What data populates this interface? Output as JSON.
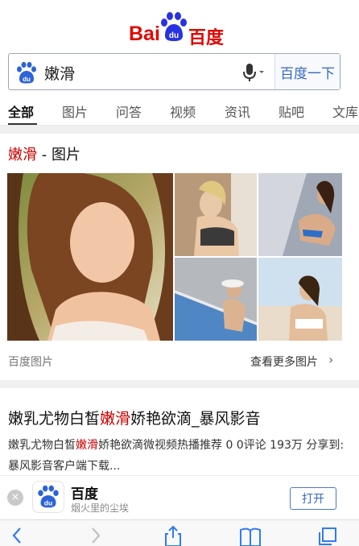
{
  "logo": {
    "word": "Bai",
    "paw_text": "du",
    "cn": "百度"
  },
  "search": {
    "query": "嫩滑",
    "button_label": "百度一下"
  },
  "tabs": [
    {
      "label": "全部",
      "active": true
    },
    {
      "label": "图片"
    },
    {
      "label": "问答"
    },
    {
      "label": "视频"
    },
    {
      "label": "资讯"
    },
    {
      "label": "贴吧"
    },
    {
      "label": "文库"
    }
  ],
  "image_card": {
    "title_highlight": "嫩滑",
    "title_rest": " - 图片",
    "source": "百度图片",
    "more_link": "查看更多图片"
  },
  "result": {
    "title_prefix": "嫩乳尤物白皙",
    "title_highlight": "嫩滑",
    "title_suffix": "娇艳欲滴_暴风影音",
    "desc_prefix": "嫩乳尤物白皙",
    "desc_highlight": "嫩滑",
    "desc_suffix": "娇艳欲滴微视频热播推荐 0 0评论 193万 分享到: 暴风影音客户端下载..."
  },
  "app_banner": {
    "close_glyph": "×",
    "name": "百度",
    "subtitle": "烟火里的尘埃",
    "open_label": "打开"
  },
  "colors": {
    "brand_red": "#e10601",
    "brand_blue": "#2932e1",
    "link_blue": "#3568c4",
    "highlight": "#cc0000"
  }
}
